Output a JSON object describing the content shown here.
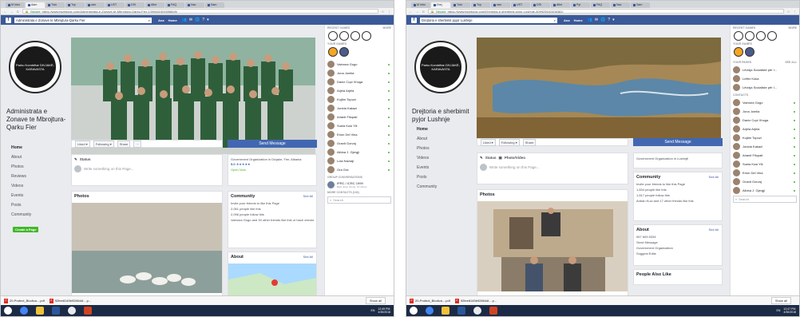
{
  "colors": {
    "fb_blue": "#3b5998",
    "send": "#4267b2",
    "online": "#42b72a"
  },
  "left": {
    "tabs": [
      "M Inbo",
      "Adm",
      "Tuto",
      "Top",
      "ram",
      "UST",
      "DSI",
      "Albe",
      "FAQ",
      "Nav",
      "Sam"
    ],
    "url_secure": "Secure",
    "url": "https://www.facebook.com/Administrata-e-Zonave-te-Mbrojtura-Qarku-Fier-1390682404598849/",
    "search": "Administrata e Zonave te Mbrojtura-Qarku Fier",
    "user": "Ana",
    "home": "Home",
    "page_name": "Administrata e Zonave te Mbrojtura-Qarku Fier",
    "logo_text": "Parku Kombëtar DIVJAKË-KARAVASTA",
    "menu": [
      "Home",
      "About",
      "Photos",
      "Reviews",
      "Videos",
      "Events",
      "Posts",
      "Community"
    ],
    "create": "Create a Page",
    "liked": "Liked ▾",
    "following": "Following ▾",
    "share": "Share",
    "more": "···",
    "send": "Send Message",
    "status": "Status",
    "write": "Write something on this Page...",
    "category": "Government Organization in Divjake, Fier, Albania",
    "rating": "5.0",
    "open": "Open Now",
    "photos": "Photos",
    "community": "Community",
    "see_all": "See All",
    "comm_lines": [
      "Invite your friends to like this Page",
      "2,061 people like this",
      "2,096 people follow this",
      "Vaimora Gogo and 30 other friends like this or have checked in"
    ],
    "about": "About",
    "about_see": "See All",
    "sb_games": "RECENT GAMES",
    "sb_more": "MORE",
    "sb_your": "YOUR GAMES",
    "contacts": [
      "Vaimora Gogo",
      "Juna Jumila",
      "Daniz Cupi Xhoga",
      "Arjela Arjela",
      "Kujtim Topuzi",
      "Jonida Kakazi",
      "Arianit Fllopati",
      "Suela Kosi Yili",
      "Erion Del Vina",
      "Granit Gorvaj",
      "Albina J. Gjergji",
      "Lola Navraji",
      "Gra Gra"
    ],
    "group": "GROUP CONVERSATIONS",
    "group_item": "IPRC / ICRC 1999",
    "group_sub": "Bled, Engi, Rome, 10 others",
    "more_contacts": "MORE CONTACTS (130)",
    "search_sb": "Search",
    "dl": [
      "20-Profect_Biodiva....pdf",
      "92fee8145b92864dl....p..."
    ],
    "showall": "Show all",
    "time": "12:49 PM",
    "date": "4/30/2018",
    "lang": "EN"
  },
  "right": {
    "tabs": [
      "M Inbo",
      "Drej",
      "Tuto",
      "Top",
      "ram",
      "UST",
      "DSI",
      "Albe",
      "Pyt",
      "FAQ",
      "Nav",
      "Sam"
    ],
    "url_secure": "Secure",
    "url": "https://www.facebook.com/Drejtoria-e-sherbimit-pyjor-Lushnje-409925542406381/",
    "search": "Drejtoria e sherbimit pyjor Lushnje",
    "user": "Ana",
    "home": "Home",
    "page_name": "Drejtoria e sherbimit pyjor Lushnje",
    "menu": [
      "Home",
      "About",
      "Photos",
      "Videos",
      "Events",
      "Posts",
      "Community"
    ],
    "liked": "Liked ▾",
    "following": "Following ▾",
    "share": "Share",
    "send": "Send Message",
    "status": "Status",
    "photo_video": "Photo/Video",
    "write": "Write something on this Page...",
    "category": "Government Organization in Lushnjë",
    "photos": "Photos",
    "community": "Community",
    "see_all": "See All",
    "comm_lines": [
      "Invite your friends to like this Page",
      "1,834 people like this",
      "1,817 people follow this",
      "Ardian Kuci and 17 other friends like this"
    ],
    "about": "About",
    "about_see": "See All",
    "about_lines": [
      "067 609 6334",
      "Send Message",
      "Government Organization",
      "Suggest Edits"
    ],
    "people": "People Also Like",
    "sb_games": "RECENT GAMES",
    "sb_more": "MORE",
    "sb_your": "YOUR GAMES",
    "pages_head": "YOUR PAGES",
    "pages_see": "SEE ALL",
    "pages": [
      "Lëvizja Socialiste për I...",
      "Lefter Koka",
      "Lëvizja Socialiste për I..."
    ],
    "contacts_head": "CONTACTS",
    "contacts": [
      "Vaimora Gogo",
      "Juna Jumila",
      "Daniz Cupi Xhoga",
      "Arjela Arjela",
      "Kujtim Topuzi",
      "Jonida Kakazi",
      "Arianit Fllopati",
      "Suela Kosi Yili",
      "Erion Del Vina",
      "Granit Gorvaj",
      "Albina J. Gjergji"
    ],
    "search_sb": "Search",
    "dl": [
      "20-Profect_Biodiva....pdf",
      "92fee8145b92864dl....p..."
    ],
    "showall": "Show all",
    "time": "12:47 PM",
    "date": "4/30/2018",
    "lang": "EN"
  }
}
